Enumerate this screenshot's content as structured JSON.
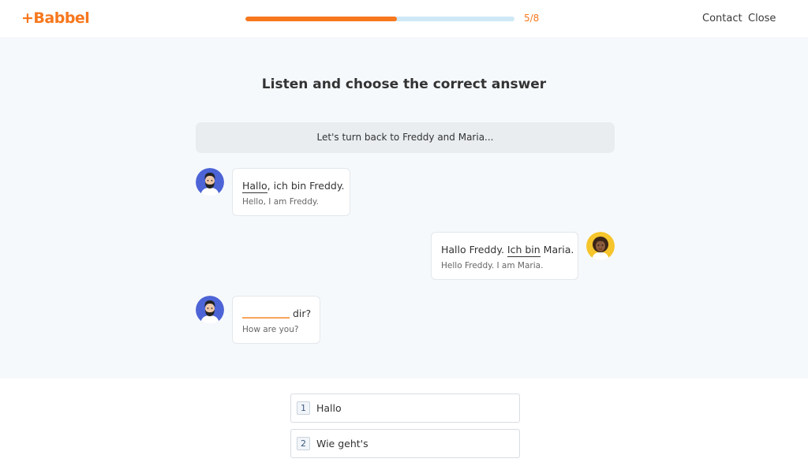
{
  "header": {
    "logo": "+Babbel",
    "progress_fraction": 0.5625,
    "progress_count": "5/8",
    "contact": "Contact",
    "close": "Close"
  },
  "lesson": {
    "title": "Listen and choose the correct answer",
    "intro": "Let's turn back to Freddy and Maria...",
    "messages": [
      {
        "speaker": "Freddy",
        "side": "left",
        "word": "Hallo",
        "rest": ", ich bin Freddy.",
        "translation": "Hello, I am Freddy."
      },
      {
        "speaker": "Maria",
        "side": "right",
        "before": "Hallo Freddy. ",
        "word": "Ich bin",
        "rest": " Maria.",
        "translation": "Hello Freddy. I am Maria."
      },
      {
        "speaker": "Freddy",
        "side": "left",
        "rest": "dir?",
        "translation": "How are you?"
      }
    ]
  },
  "answers": [
    {
      "num": "1",
      "text": "Hallo"
    },
    {
      "num": "2",
      "text": "Wie geht's"
    }
  ],
  "colors": {
    "accent": "#f7771d",
    "progress_track": "#cfe8f6",
    "freddy_avatar_bg": "#4c64d6",
    "maria_avatar_bg": "#f5c52b"
  },
  "icons": {
    "freddy": "bearded-man-avatar-icon",
    "maria": "woman-curly-hair-avatar-icon"
  }
}
